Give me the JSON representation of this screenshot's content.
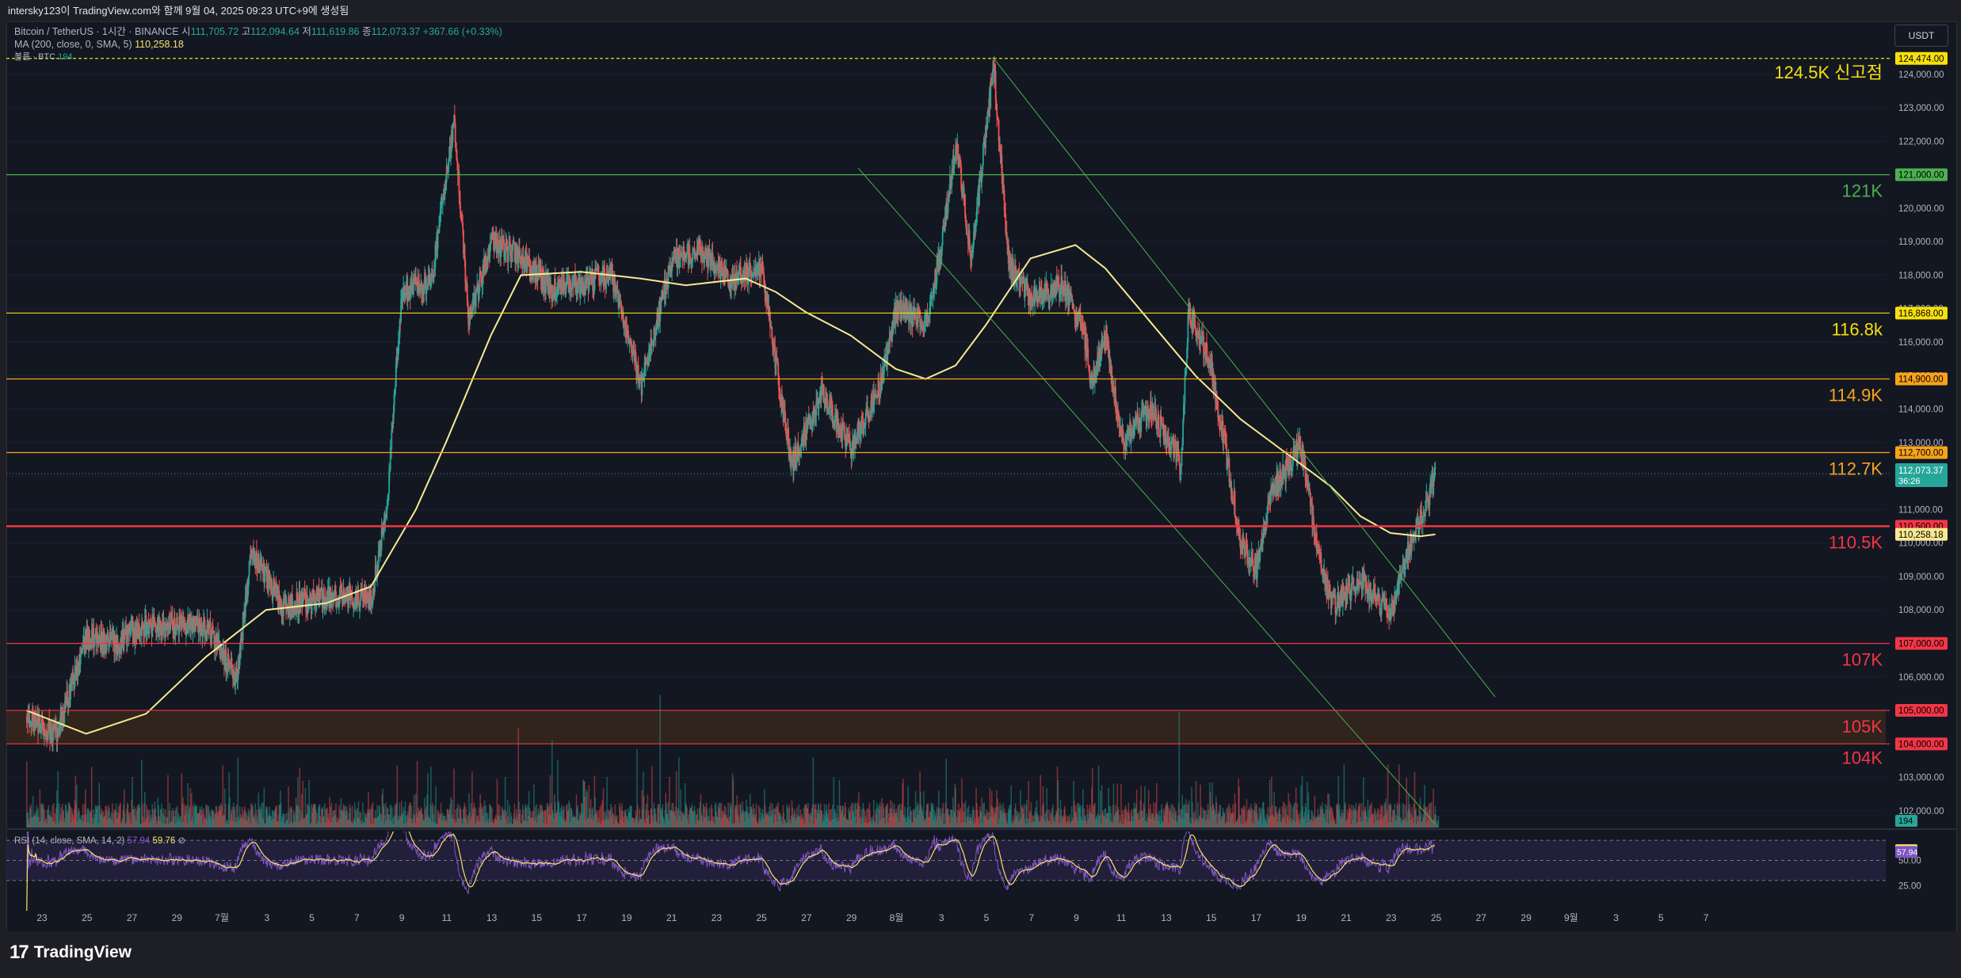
{
  "header": {
    "snapshot_text": "intersky123이 TradingView.com와 함께 9월 04, 2025 09:23 UTC+9에 생성됨"
  },
  "legend": {
    "symbol": "Bitcoin / TetherUS · 1시간 · BINANCE",
    "o_label": "시",
    "o_value": "111,705.72",
    "h_label": "고",
    "h_value": "112,094.64",
    "l_label": "저",
    "l_value": "111,619.86",
    "c_label": "종",
    "c_value": "112,073.37",
    "change": "+367.66 (+0.33%)",
    "ma_label": "MA (200, close, 0, SMA, 5)",
    "ma_value": "110,258.18",
    "vol_label": "볼륨 · BTC",
    "vol_value": "194"
  },
  "rsi_legend": {
    "label": "RSI (14, close, SMA, 14, 2)",
    "value1": "57.94",
    "value2": "59.76"
  },
  "currency": "USDT",
  "branding": {
    "name": "TradingView",
    "mark": "17"
  },
  "colors": {
    "up": "#26a69a",
    "down": "#ef5350",
    "ma": "#f7e891",
    "green_level": "#4caf50",
    "yellow_level": "#f7e00c",
    "orange_level": "#f7a21b",
    "red_level": "#f23645",
    "rsi": "#7e57c2"
  },
  "chart_data": [
    {
      "type": "candlestick",
      "title": "Bitcoin / TetherUS · 1시간 · BINANCE",
      "ylim": [
        101500,
        124800
      ],
      "x_ticks": [
        "23",
        "25",
        "27",
        "29",
        "7월",
        "3",
        "5",
        "7",
        "9",
        "11",
        "13",
        "15",
        "17",
        "19",
        "21",
        "23",
        "25",
        "27",
        "29",
        "8월",
        "3",
        "5",
        "7",
        "9",
        "11",
        "13",
        "15",
        "17",
        "19",
        "21",
        "23",
        "25",
        "27",
        "29",
        "9월",
        "3",
        "5",
        "7"
      ],
      "y_ticks": [
        102000,
        103000,
        104000,
        105000,
        106000,
        107000,
        108000,
        109000,
        110000,
        111000,
        112000,
        113000,
        114000,
        115000,
        116000,
        117000,
        118000,
        119000,
        120000,
        121000,
        122000,
        123000,
        124000
      ],
      "price_path": [
        {
          "day": 0,
          "close": 104800
        },
        {
          "day": 2,
          "close": 104300
        },
        {
          "day": 4,
          "close": 107200
        },
        {
          "day": 6,
          "close": 107000
        },
        {
          "day": 8,
          "close": 107500
        },
        {
          "day": 10,
          "close": 107600
        },
        {
          "day": 12,
          "close": 107500
        },
        {
          "day": 14,
          "close": 106000
        },
        {
          "day": 15,
          "close": 109800
        },
        {
          "day": 17,
          "close": 108100
        },
        {
          "day": 19,
          "close": 108300
        },
        {
          "day": 21,
          "close": 108400
        },
        {
          "day": 23,
          "close": 108400
        },
        {
          "day": 24,
          "close": 111000
        },
        {
          "day": 25,
          "close": 117500
        },
        {
          "day": 27,
          "close": 117800
        },
        {
          "day": 28.5,
          "close": 122700
        },
        {
          "day": 29.5,
          "close": 116600
        },
        {
          "day": 31,
          "close": 119000
        },
        {
          "day": 33,
          "close": 118500
        },
        {
          "day": 35,
          "close": 117600
        },
        {
          "day": 37,
          "close": 117800
        },
        {
          "day": 39,
          "close": 118000
        },
        {
          "day": 41,
          "close": 114700
        },
        {
          "day": 43,
          "close": 118400
        },
        {
          "day": 45,
          "close": 118700
        },
        {
          "day": 47,
          "close": 117800
        },
        {
          "day": 49,
          "close": 118300
        },
        {
          "day": 51,
          "close": 112300
        },
        {
          "day": 53,
          "close": 114500
        },
        {
          "day": 55,
          "close": 112800
        },
        {
          "day": 57,
          "close": 114800
        },
        {
          "day": 58,
          "close": 117000
        },
        {
          "day": 60,
          "close": 116600
        },
        {
          "day": 61,
          "close": 118800
        },
        {
          "day": 62,
          "close": 122000
        },
        {
          "day": 63,
          "close": 118500
        },
        {
          "day": 64.5,
          "close": 124300
        },
        {
          "day": 65.5,
          "close": 118300
        },
        {
          "day": 67,
          "close": 117300
        },
        {
          "day": 69,
          "close": 117700
        },
        {
          "day": 70.5,
          "close": 116400
        },
        {
          "day": 71,
          "close": 114800
        },
        {
          "day": 72,
          "close": 116200
        },
        {
          "day": 73,
          "close": 113000
        },
        {
          "day": 75,
          "close": 114000
        },
        {
          "day": 77,
          "close": 112300
        },
        {
          "day": 77.5,
          "close": 117000
        },
        {
          "day": 79,
          "close": 115300
        },
        {
          "day": 81,
          "close": 110000
        },
        {
          "day": 82,
          "close": 109200
        },
        {
          "day": 83,
          "close": 111500
        },
        {
          "day": 85,
          "close": 112900
        },
        {
          "day": 86,
          "close": 110000
        },
        {
          "day": 87,
          "close": 108100
        },
        {
          "day": 89,
          "close": 108900
        },
        {
          "day": 91,
          "close": 107800
        },
        {
          "day": 92,
          "close": 109600
        },
        {
          "day": 93,
          "close": 110700
        },
        {
          "day": 94,
          "close": 112073
        }
      ],
      "ma200_path": [
        {
          "day": 0,
          "close": 105000
        },
        {
          "day": 4,
          "close": 104300
        },
        {
          "day": 8,
          "close": 104900
        },
        {
          "day": 12,
          "close": 106600
        },
        {
          "day": 16,
          "close": 108000
        },
        {
          "day": 20,
          "close": 108200
        },
        {
          "day": 23,
          "close": 108700
        },
        {
          "day": 26,
          "close": 111000
        },
        {
          "day": 28,
          "close": 113000
        },
        {
          "day": 31,
          "close": 116200
        },
        {
          "day": 33,
          "close": 118000
        },
        {
          "day": 37,
          "close": 118100
        },
        {
          "day": 41,
          "close": 117900
        },
        {
          "day": 44,
          "close": 117700
        },
        {
          "day": 48,
          "close": 117900
        },
        {
          "day": 50,
          "close": 117500
        },
        {
          "day": 52,
          "close": 116900
        },
        {
          "day": 55,
          "close": 116200
        },
        {
          "day": 58,
          "close": 115200
        },
        {
          "day": 60,
          "close": 114900
        },
        {
          "day": 62,
          "close": 115300
        },
        {
          "day": 64,
          "close": 116500
        },
        {
          "day": 67,
          "close": 118500
        },
        {
          "day": 70,
          "close": 118900
        },
        {
          "day": 72,
          "close": 118200
        },
        {
          "day": 75,
          "close": 116600
        },
        {
          "day": 78,
          "close": 115000
        },
        {
          "day": 81,
          "close": 113700
        },
        {
          "day": 84,
          "close": 112700
        },
        {
          "day": 87,
          "close": 111700
        },
        {
          "day": 89,
          "close": 110800
        },
        {
          "day": 91,
          "close": 110300
        },
        {
          "day": 93,
          "close": 110200
        },
        {
          "day": 94,
          "close": 110258
        }
      ],
      "ma200_current": 110258.18,
      "last_price": 112073.37,
      "countdown": "36:26",
      "price_labels": [
        {
          "price": 124474,
          "text": "124,474.00",
          "color": "#f7e00c"
        },
        {
          "price": 121000,
          "text": "121,000.00",
          "color": "#4caf50"
        },
        {
          "price": 116868,
          "text": "116,868.00",
          "color": "#f7e00c"
        },
        {
          "price": 114900,
          "text": "114,900.00",
          "color": "#f7a21b"
        },
        {
          "price": 112700,
          "text": "112,700.00",
          "color": "#f7a21b"
        },
        {
          "price": 110500,
          "text": "110,500.00",
          "color": "#f23645"
        },
        {
          "price": 107000,
          "text": "107,000.00",
          "color": "#f23645"
        },
        {
          "price": 105000,
          "text": "105,000.00",
          "color": "#f23645"
        },
        {
          "price": 104000,
          "text": "104,000.00",
          "color": "#f23645"
        }
      ],
      "levels": [
        {
          "price": 124474,
          "label": "124.5K 신고점",
          "color": "#f7e00c",
          "style": "dashed"
        },
        {
          "price": 121000,
          "label": "121K",
          "color": "#4caf50",
          "style": "solid"
        },
        {
          "price": 116868,
          "label": "116.8k",
          "color": "#f7e00c",
          "style": "solid"
        },
        {
          "price": 114900,
          "label": "114.9K",
          "color": "#f7a21b",
          "style": "solid"
        },
        {
          "price": 112700,
          "label": "112.7K",
          "color": "#f7a21b",
          "style": "solid"
        },
        {
          "price": 110500,
          "label": "110.5K",
          "color": "#f23645",
          "style": "thick"
        },
        {
          "price": 107000,
          "label": "107K",
          "color": "#f23645",
          "style": "solid"
        },
        {
          "price": 105000,
          "label": "105K",
          "color": "#f23645",
          "style": "zone-top"
        },
        {
          "price": 104000,
          "label": "104K",
          "color": "#f23645",
          "style": "zone-bottom"
        }
      ],
      "channel": {
        "upper": [
          {
            "day": 64.5,
            "price": 124500
          },
          {
            "day": 98,
            "price": 105400
          }
        ],
        "lower": [
          {
            "day": 55.5,
            "price": 121200
          },
          {
            "day": 94,
            "price": 101600
          }
        ]
      },
      "volume_badge": "194"
    },
    {
      "type": "line",
      "title": "RSI (14, close, SMA, 14, 2)",
      "y_ticks": [
        25,
        50
      ],
      "bands": [
        30,
        50,
        70
      ],
      "current_rsi": 57.94,
      "current_rsi_ma": 59.76
    }
  ]
}
